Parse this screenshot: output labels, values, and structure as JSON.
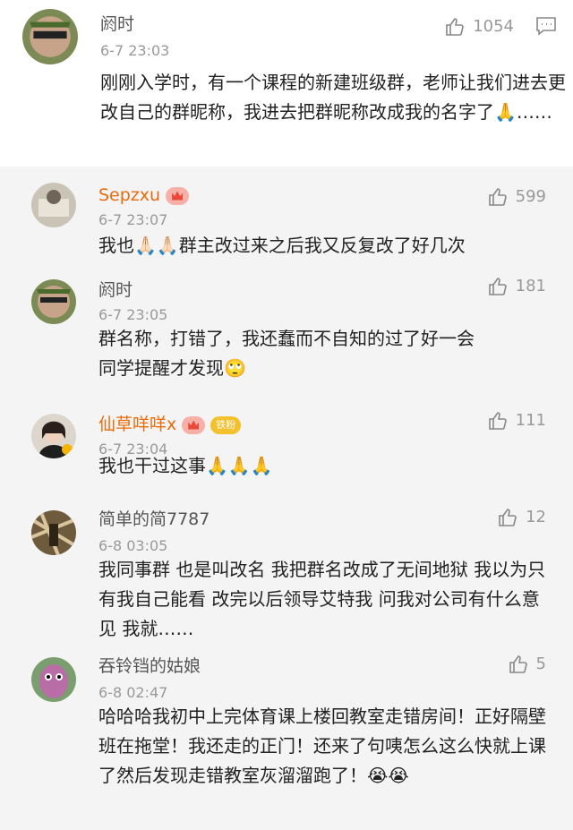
{
  "main_comment": {
    "name": "阏时",
    "time": "6-7 23:03",
    "text": "刚刚入学时，有一个课程的新建班级群，老师让我们进去更改自己的群昵称，我进去把群昵称改成我的名字了🙏……",
    "likes": "1054",
    "like_icon": "thumb-up-icon",
    "reply_icon": "comment-icon"
  },
  "replies": [
    {
      "name": "Sepzxu",
      "time": "6-7 23:07",
      "text": "我也🙏🏻🙏🏻群主改过来之后我又反复改了好几次",
      "likes": "599",
      "badge": "crown"
    },
    {
      "name": "阏时",
      "time": "6-7 23:05",
      "text": "群名称，打错了，我还蠢而不自知的过了好一会同学提醒才发现🙄",
      "likes": "181"
    },
    {
      "name": "仙草咩咩x",
      "time": "6-7 23:04",
      "text": "我也干过这事🙏🙏🙏",
      "likes": "111",
      "badge_text": "铁粉"
    },
    {
      "name": "简单的简7787",
      "time": "6-8 03:05",
      "text": "我同事群 也是叫改名 我把群名改成了无间地狱 我以为只有我自己能看 改完以后领导艾特我 问我对公司有什么意见 我就……",
      "likes": "12"
    },
    {
      "name": "吞铃铛的姑娘",
      "time": "6-8 02:47",
      "text": "哈哈哈我初中上完体育课上楼回教室走错房间！正好隔壁班在拖堂！我还走的正门！还来了句咦怎么这么快就上课了然后发现走错教室灰溜溜跑了！😭😭",
      "likes": "5"
    }
  ],
  "colors": {
    "vip_name": "#e86b0c",
    "name": "#555555",
    "time": "#999999",
    "text": "#222222"
  }
}
